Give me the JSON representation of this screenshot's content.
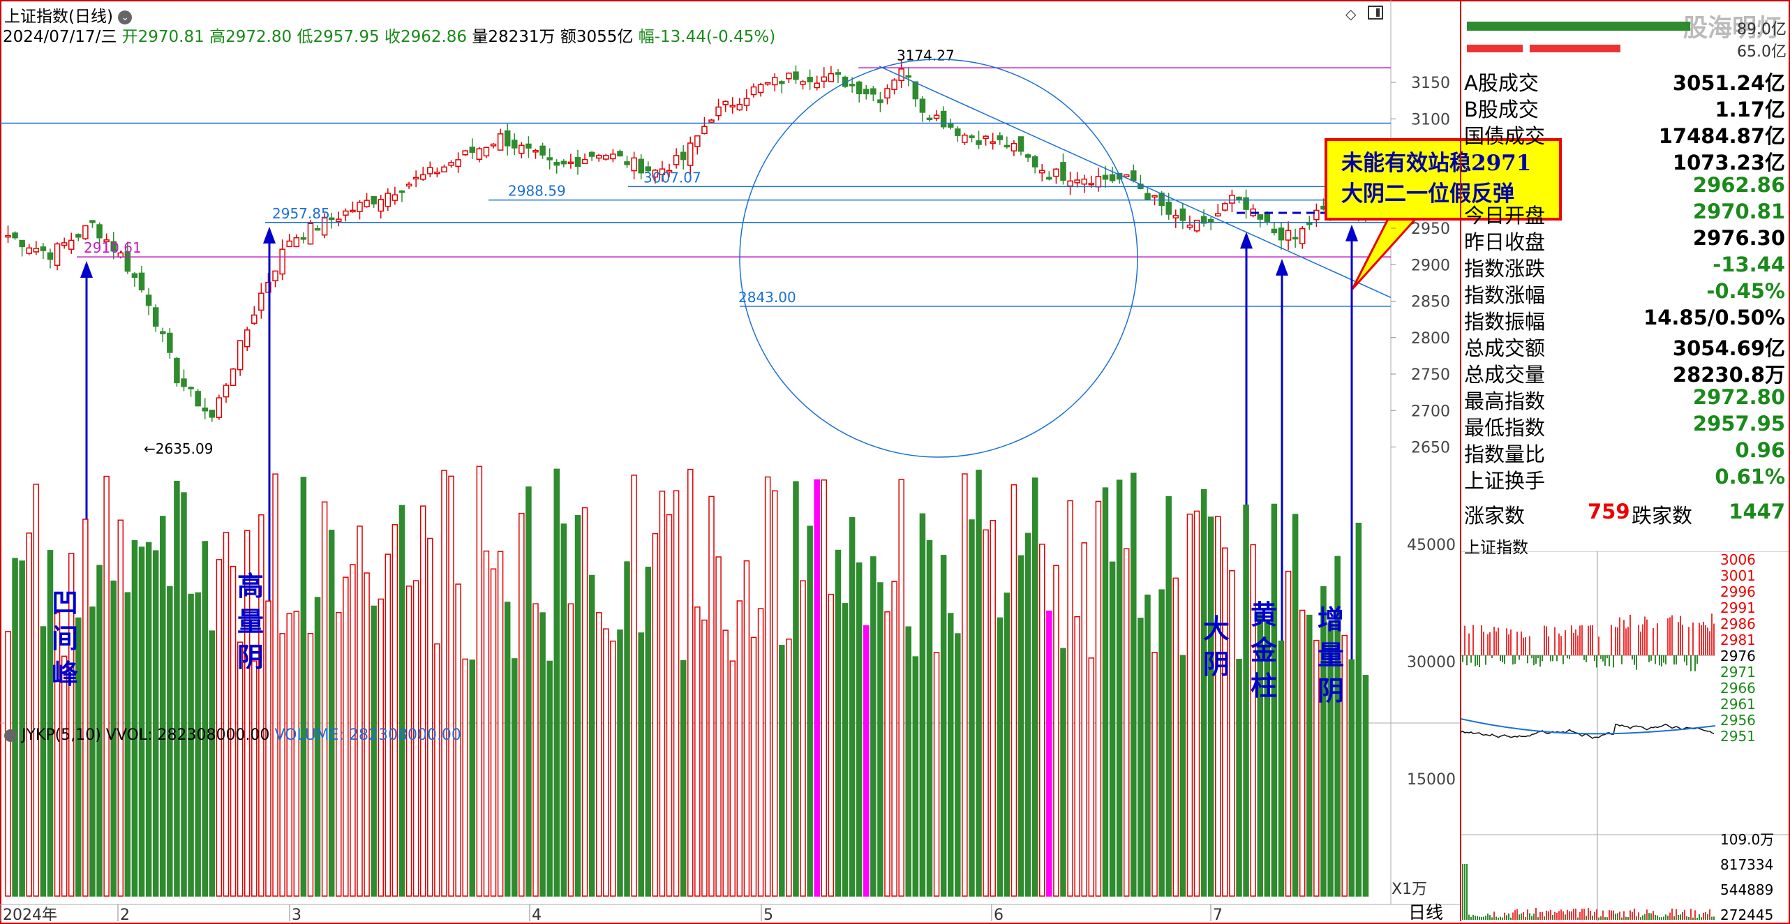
{
  "header": {
    "title": "上证指数(日线)",
    "date": "2024/07/17/三",
    "open": "开2970.81",
    "high": "高2972.80",
    "low": "低2957.95",
    "close": "收2962.86",
    "vol": "量28231万",
    "amount": "额3055亿",
    "change": "幅-13.44(-0.45%)"
  },
  "watermark": "股海明灯",
  "volume_header": {
    "indicator": "JYKP(5,10)",
    "vvol": "VVOL: 282308000.00",
    "volume": "VOLUME: 282308000.00"
  },
  "volume_unit": "X1万",
  "period_tab": "日线",
  "chart_data": {
    "type": "candlestick",
    "y_axis": [
      3150,
      3100,
      3050,
      3000,
      2950,
      2900,
      2850,
      2800,
      2750,
      2700,
      2650
    ],
    "x_labels": [
      "2024年",
      "2",
      "3",
      "4",
      "5",
      "6",
      "7"
    ],
    "volume_axis": [
      45000,
      30000,
      15000
    ],
    "price_marks": [
      "3174.27",
      "3007.07",
      "2988.59",
      "2957.85",
      "2910.61",
      "2843.00",
      "2635.09"
    ],
    "annotations": [
      {
        "text": "凹间峰"
      },
      {
        "text": "高量阴"
      },
      {
        "text": "大阴"
      },
      {
        "text": "黄金柱"
      },
      {
        "text": "增量阴"
      }
    ],
    "callout": [
      "未能有效站稳2971",
      "大阴二一位假反弹"
    ],
    "last_candle": {
      "open": 2970.81,
      "high": 2972.8,
      "low": 2957.95,
      "close": 2962.86,
      "volume": 28231
    },
    "colors": {
      "up": "#e00000",
      "down": "#2e8b2e",
      "highlight_volume": "#ff00ff",
      "guide": "#1a6fd8"
    }
  },
  "right_panel": {
    "top_values": [
      "89.0亿",
      "65.0亿"
    ],
    "rows": [
      {
        "label": "A股成交",
        "value": "3051.24亿",
        "color": "#000"
      },
      {
        "label": "B股成交",
        "value": "1.17亿",
        "color": "#000"
      },
      {
        "label": "国债成交",
        "value": "17484.87亿",
        "color": "#000"
      },
      {
        "label": "",
        "value": "1073.23亿",
        "color": "#000"
      },
      {
        "label": "",
        "value": "2962.86",
        "color": "#1a8a1a"
      },
      {
        "label": "今日开盘",
        "value": "2970.81",
        "color": "#1a8a1a"
      },
      {
        "label": "昨日收盘",
        "value": "2976.30",
        "color": "#000"
      },
      {
        "label": "指数涨跌",
        "value": "-13.44",
        "color": "#1a8a1a"
      },
      {
        "label": "指数涨幅",
        "value": "-0.45%",
        "color": "#1a8a1a"
      },
      {
        "label": "指数振幅",
        "value": "14.85/0.50%",
        "color": "#000"
      },
      {
        "label": "总成交额",
        "value": "3054.69亿",
        "color": "#000"
      },
      {
        "label": "总成交量",
        "value": "28230.8万",
        "color": "#000"
      },
      {
        "label": "最高指数",
        "value": "2972.80",
        "color": "#1a8a1a"
      },
      {
        "label": "最低指数",
        "value": "2957.95",
        "color": "#1a8a1a"
      },
      {
        "label": "指数量比",
        "value": "0.96",
        "color": "#1a8a1a"
      },
      {
        "label": "上证换手",
        "value": "0.61%",
        "color": "#1a8a1a"
      }
    ],
    "updown": {
      "up_label": "涨家数",
      "up_value": "759",
      "down_label": "跌家数",
      "down_value": "1447"
    },
    "mini_title": "上证指数",
    "mini_axis": [
      "3006",
      "3001",
      "2996",
      "2991",
      "2986",
      "2981",
      "2976",
      "2971",
      "2966",
      "2961",
      "2956",
      "2951"
    ],
    "mini_vol_axis": [
      "109.0万",
      "817334",
      "544889",
      "272445"
    ]
  }
}
